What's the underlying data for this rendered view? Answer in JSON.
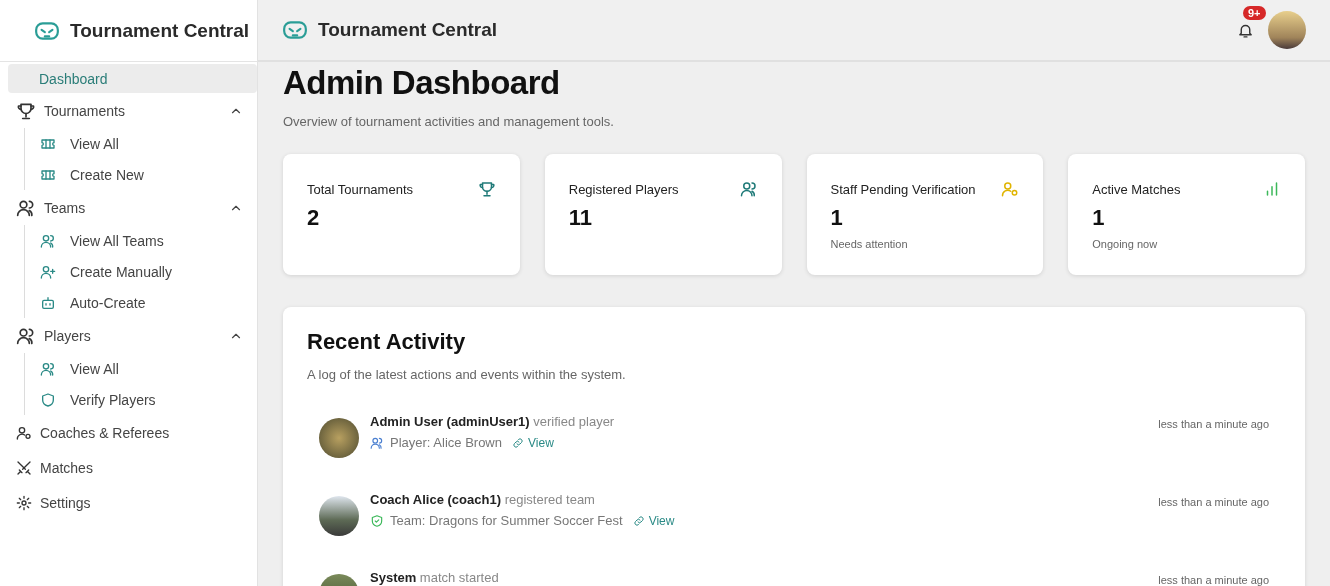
{
  "sidebar": {
    "brand": "Tournament Central",
    "items": [
      {
        "label": "Dashboard",
        "selected": true
      },
      {
        "label": "Tournaments",
        "selected": false,
        "expanded": true,
        "children": [
          {
            "label": "View All",
            "selected": false
          },
          {
            "label": "Create New",
            "selected": false
          }
        ]
      },
      {
        "label": "Teams",
        "selected": false,
        "expanded": true,
        "children": [
          {
            "label": "View All Teams",
            "selected": false
          },
          {
            "label": "Create Manually",
            "selected": false
          },
          {
            "label": "Auto-Create",
            "selected": false
          }
        ]
      },
      {
        "label": "Players",
        "selected": false,
        "expanded": true,
        "children": [
          {
            "label": "View All",
            "selected": false
          },
          {
            "label": "Verify Players",
            "selected": false
          }
        ]
      },
      {
        "label": "Coaches & Referees",
        "selected": false
      },
      {
        "label": "Matches",
        "selected": false
      },
      {
        "label": "Settings",
        "selected": false
      }
    ]
  },
  "header": {
    "brand": "Tournament Central",
    "notification_badge": "9+"
  },
  "page": {
    "title": "Admin Dashboard",
    "subtitle": "Overview of tournament activities and management tools."
  },
  "stats": [
    {
      "title": "Total Tournaments",
      "value": "2",
      "color": "#1f7a78"
    },
    {
      "title": "Registered Players",
      "value": "11",
      "color": "#1f7a78"
    },
    {
      "title": "Staff Pending Verification",
      "value": "1",
      "note": "Needs attention",
      "color": "#e0b400"
    },
    {
      "title": "Active Matches",
      "value": "1",
      "note": "Ongoing now",
      "color": "#3cb85a"
    }
  ],
  "recent_activity": {
    "title": "Recent Activity",
    "subtitle": "A log of the latest actions and events within the system.",
    "items": [
      {
        "actor": "Admin User (adminUser1)",
        "action": "verified player",
        "detail": {
          "kind": "player",
          "text": "Player: Alice Brown",
          "link": "View"
        },
        "time": "less than a minute ago"
      },
      {
        "actor": "Coach Alice (coach1)",
        "action": "registered team",
        "detail": {
          "kind": "team",
          "text": "Team: Dragons for Summer Soccer Fest",
          "link": "View"
        },
        "time": "less than a minute ago"
      },
      {
        "actor": "System",
        "action": "match started",
        "time": "less than a minute ago"
      }
    ]
  }
}
